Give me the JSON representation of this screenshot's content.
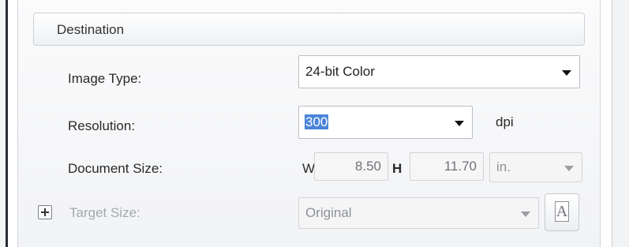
{
  "section": {
    "title": "Destination"
  },
  "image_type": {
    "label": "Image Type:",
    "value": "24-bit Color"
  },
  "resolution": {
    "label": "Resolution:",
    "value": "300",
    "unit": "dpi"
  },
  "document_size": {
    "label": "Document Size:",
    "width_label": "W",
    "width_value": "8.50",
    "height_label": "H",
    "height_value": "11.70",
    "unit": "in."
  },
  "target_size": {
    "label": "Target Size:",
    "value": "Original",
    "adjust_button_text": "A"
  }
}
